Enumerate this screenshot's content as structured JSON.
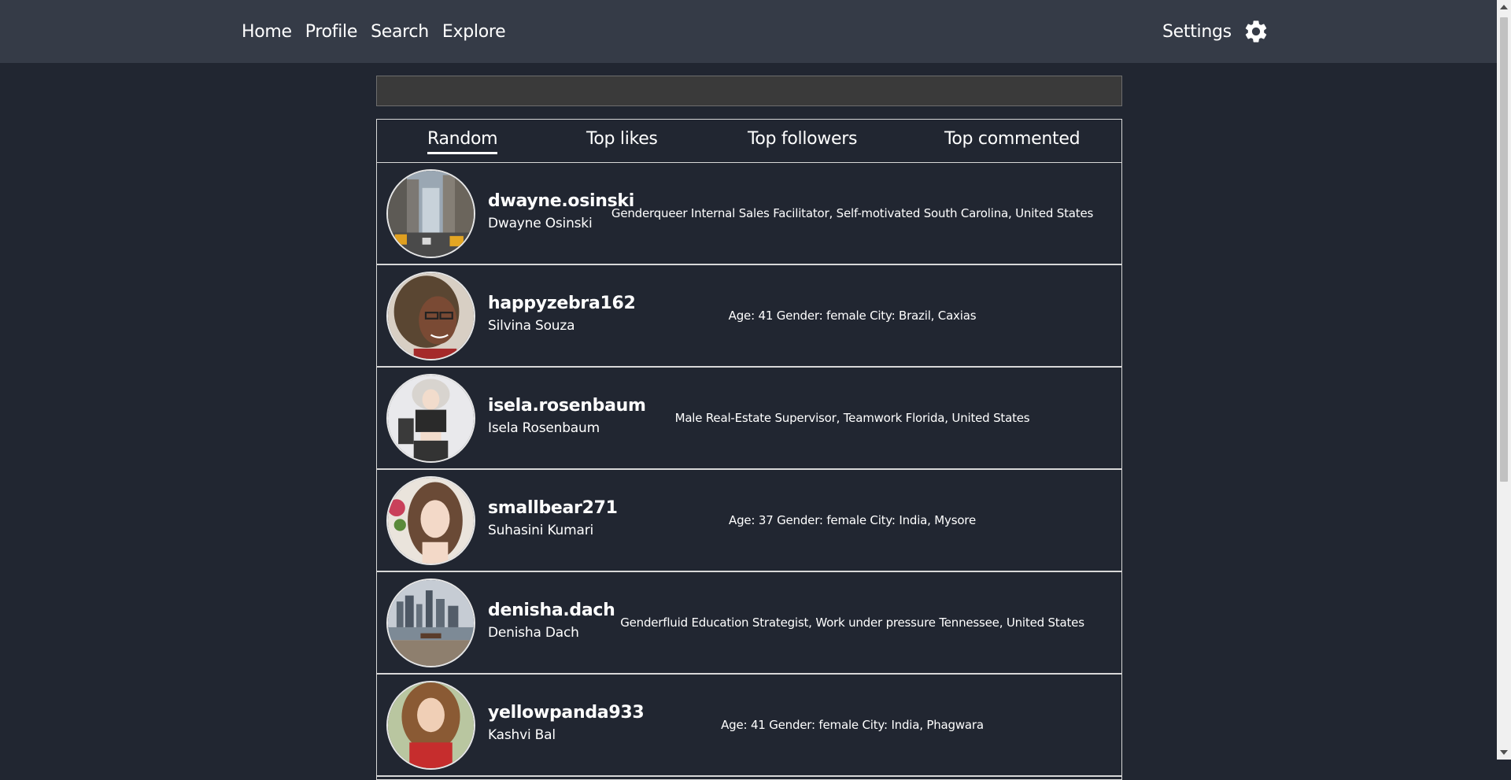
{
  "nav": {
    "links": [
      "Home",
      "Profile",
      "Search",
      "Explore"
    ],
    "settings_label": "Settings",
    "settings_icon": "gear-icon"
  },
  "search": {
    "value": "",
    "placeholder": ""
  },
  "tabs": [
    {
      "label": "Random",
      "active": true
    },
    {
      "label": "Top likes",
      "active": false
    },
    {
      "label": "Top followers",
      "active": false
    },
    {
      "label": "Top commented",
      "active": false
    }
  ],
  "users": [
    {
      "username": "dwayne.osinski",
      "name": "Dwayne Osinski",
      "bio": "Genderqueer Internal Sales Facilitator, Self-motivated South Carolina, United States",
      "avatar": "city-street-photo"
    },
    {
      "username": "happyzebra162",
      "name": "Silvina Souza",
      "bio": "Age: 41 Gender: female City: Brazil, Caxias",
      "avatar": "woman-glasses-photo"
    },
    {
      "username": "isela.rosenbaum",
      "name": "Isela Rosenbaum",
      "bio": "Male Real-Estate Supervisor, Teamwork Florida, United States",
      "avatar": "anime-character-photo"
    },
    {
      "username": "smallbear271",
      "name": "Suhasini Kumari",
      "bio": "Age: 37 Gender: female City: India, Mysore",
      "avatar": "woman-portrait-photo"
    },
    {
      "username": "denisha.dach",
      "name": "Denisha Dach",
      "bio": "Genderfluid Education Strategist, Work under pressure Tennessee, United States",
      "avatar": "city-skyline-photo"
    },
    {
      "username": "yellowpanda933",
      "name": "Kashvi Bal",
      "bio": "Age: 41 Gender: female City: India, Phagwara",
      "avatar": "woman-red-top-photo"
    }
  ],
  "colors": {
    "background": "#212631",
    "topbar": "#353b47",
    "border": "#d8d8d8",
    "search_bg": "#3a3a3a"
  }
}
